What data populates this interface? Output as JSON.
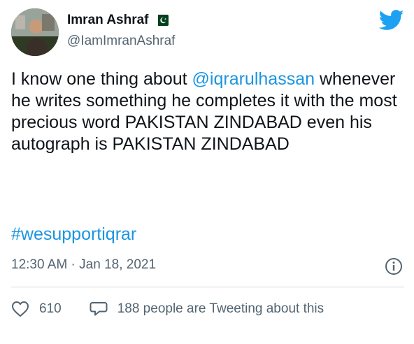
{
  "tweet": {
    "author": {
      "name": "Imran Ashraf",
      "handle": "@IamImranAshraf"
    },
    "body_prefix": "I know one thing about ",
    "mention": "@iqrarulhassan",
    "body_suffix": " whenever he writes something he completes it with the most precious word PAKISTAN ZINDABAD even his autograph is PAKISTAN ZINDABAD",
    "hashtag": "#wesupportiqrar",
    "timestamp": "12:30 AM · Jan 18, 2021",
    "likes": "610",
    "replies_text": "188 people are Tweeting about this"
  },
  "icons": {
    "brand": "twitter-bird-icon",
    "flag": "pakistan-flag-icon",
    "info": "info-icon",
    "like": "heart-icon",
    "reply": "speech-bubble-icon"
  },
  "colors": {
    "link": "#1b95e0",
    "brand": "#1da1f2",
    "secondary_text": "#536471",
    "primary_text": "#0f1419"
  }
}
